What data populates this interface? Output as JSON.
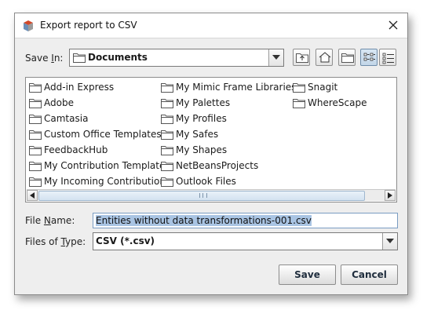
{
  "window": {
    "title": "Export report to CSV"
  },
  "save_in": {
    "label": "Save In:",
    "label_pre": "Save ",
    "label_u": "I",
    "label_post": "n:",
    "value": "Documents"
  },
  "toolbar": {
    "up_folder_icon": "up-one-level-icon",
    "home_icon": "home-icon",
    "new_folder_icon": "new-folder-icon",
    "list_view_icon": "list-view-icon",
    "details_view_icon": "details-view-icon"
  },
  "files": {
    "col1": [
      "Add-in Express",
      "Adobe",
      "Camtasia",
      "Custom Office Templates",
      "FeedbackHub",
      "My Contribution Templates",
      "My Incoming Contributions"
    ],
    "col2": [
      "My Mimic Frame Libraries",
      "My Palettes",
      "My Profiles",
      "My Safes",
      "My Shapes",
      "NetBeansProjects",
      "Outlook Files"
    ],
    "col3": [
      "Snagit",
      "WhereScape"
    ]
  },
  "file_name": {
    "label": "File Name:",
    "label_pre": "File ",
    "label_u": "N",
    "label_post": "ame:",
    "value": "Entities without data transformations-001.csv"
  },
  "file_type": {
    "label": "Files of Type:",
    "label_pre": "Files of ",
    "label_u": "T",
    "label_post": "ype:",
    "value": "CSV (*.csv)"
  },
  "buttons": {
    "save": "Save",
    "cancel": "Cancel"
  }
}
